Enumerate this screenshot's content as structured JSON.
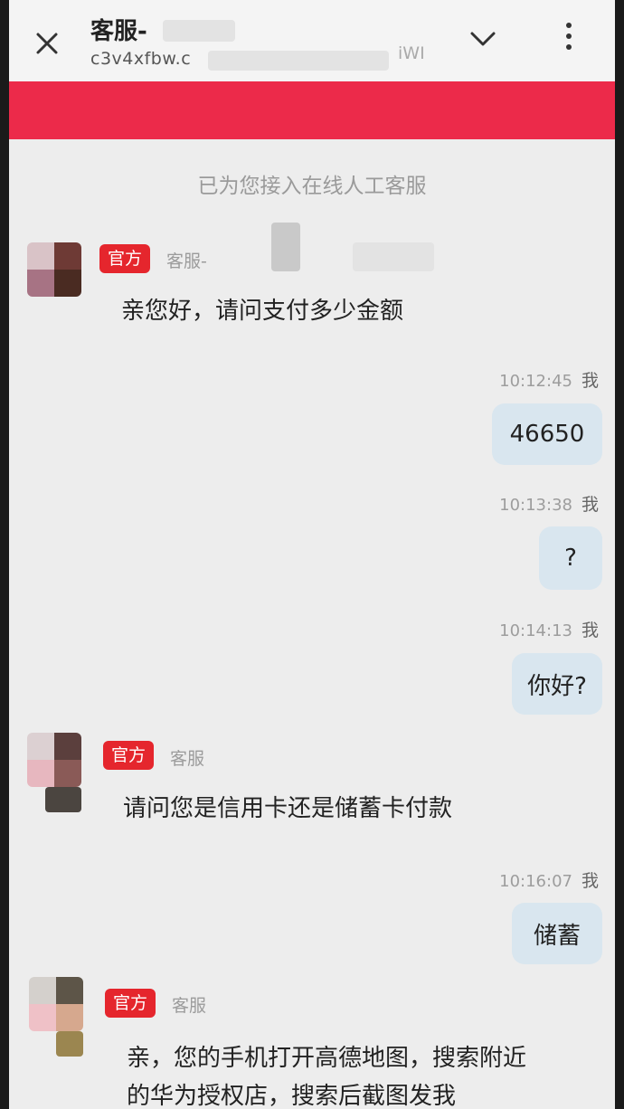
{
  "header": {
    "title": "客服-",
    "subtitle": "c3v4xfbw.c",
    "subtitle_tail": "iWI",
    "close_icon": "close-icon",
    "dropdown_icon": "chevron-down-icon",
    "more_icon": "more-vertical-icon"
  },
  "colors": {
    "banner": "#ec2a4a",
    "official_tag": "#e5262d",
    "outgoing_bubble": "#d9e6ef"
  },
  "system_notice": "已为您接入在线人工客服",
  "messages": [
    {
      "tag": "官方",
      "sender": "客服-",
      "text": "亲您好，请问支付多少金额"
    },
    {
      "time": "10:12:45",
      "me": "我",
      "text": "46650"
    },
    {
      "time": "10:13:38",
      "me": "我",
      "text": "?"
    },
    {
      "time": "10:14:13",
      "me": "我",
      "text": "你好?"
    },
    {
      "tag": "官方",
      "sender": "客服",
      "text": "请问您是信用卡还是储蓄卡付款"
    },
    {
      "time": "10:16:07",
      "me": "我",
      "text": "储蓄"
    },
    {
      "tag": "官方",
      "sender": "客服",
      "text_line1": "亲，您的手机打开高德地图，搜索附近",
      "text_line2": "的华为授权店，搜索后截图发我"
    }
  ]
}
